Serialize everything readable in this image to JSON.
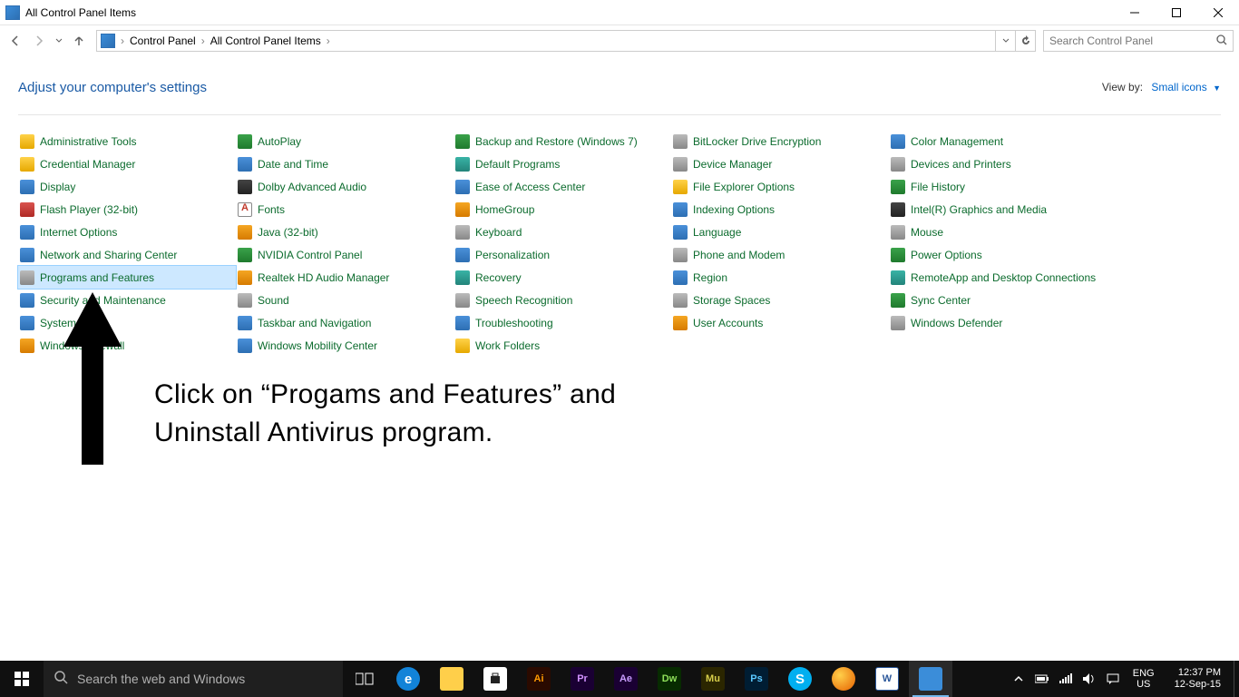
{
  "window": {
    "title": "All Control Panel Items"
  },
  "breadcrumb": {
    "seg1": "Control Panel",
    "seg2": "All Control Panel Items"
  },
  "search": {
    "placeholder": "Search Control Panel"
  },
  "header": {
    "title": "Adjust your computer's settings",
    "viewby_label": "View by:",
    "viewby_value": "Small icons"
  },
  "items": {
    "r0": {
      "c0": "Administrative Tools",
      "c1": "AutoPlay",
      "c2": "Backup and Restore (Windows 7)",
      "c3": "BitLocker Drive Encryption",
      "c4": "Color Management"
    },
    "r1": {
      "c0": "Credential Manager",
      "c1": "Date and Time",
      "c2": "Default Programs",
      "c3": "Device Manager",
      "c4": "Devices and Printers"
    },
    "r2": {
      "c0": "Display",
      "c1": "Dolby Advanced Audio",
      "c2": "Ease of Access Center",
      "c3": "File Explorer Options",
      "c4": "File History"
    },
    "r3": {
      "c0": "Flash Player (32-bit)",
      "c1": "Fonts",
      "c2": "HomeGroup",
      "c3": "Indexing Options",
      "c4": "Intel(R) Graphics and Media"
    },
    "r4": {
      "c0": "Internet Options",
      "c1": "Java (32-bit)",
      "c2": "Keyboard",
      "c3": "Language",
      "c4": "Mouse"
    },
    "r5": {
      "c0": "Network and Sharing Center",
      "c1": "NVIDIA Control Panel",
      "c2": "Personalization",
      "c3": "Phone and Modem",
      "c4": "Power Options"
    },
    "r6": {
      "c0": "Programs and Features",
      "c1": "Realtek HD Audio Manager",
      "c2": "Recovery",
      "c3": "Region",
      "c4": "RemoteApp and Desktop Connections"
    },
    "r7": {
      "c0": "Security and Maintenance",
      "c1": "Sound",
      "c2": "Speech Recognition",
      "c3": "Storage Spaces",
      "c4": "Sync Center"
    },
    "r8": {
      "c0": "System",
      "c1": "Taskbar and Navigation",
      "c2": "Troubleshooting",
      "c3": "User Accounts",
      "c4": "Windows Defender"
    },
    "r9": {
      "c0": "Windows Firewall",
      "c1": "Windows Mobility Center",
      "c2": "Work Folders"
    }
  },
  "annotation": {
    "line1": "Click on “Progams and Features” and",
    "line2": "Uninstall Antivirus program."
  },
  "taskbar": {
    "search_placeholder": "Search the web and Windows",
    "lang1": "ENG",
    "lang2": "US",
    "time": "12:37 PM",
    "date": "12-Sep-15"
  }
}
